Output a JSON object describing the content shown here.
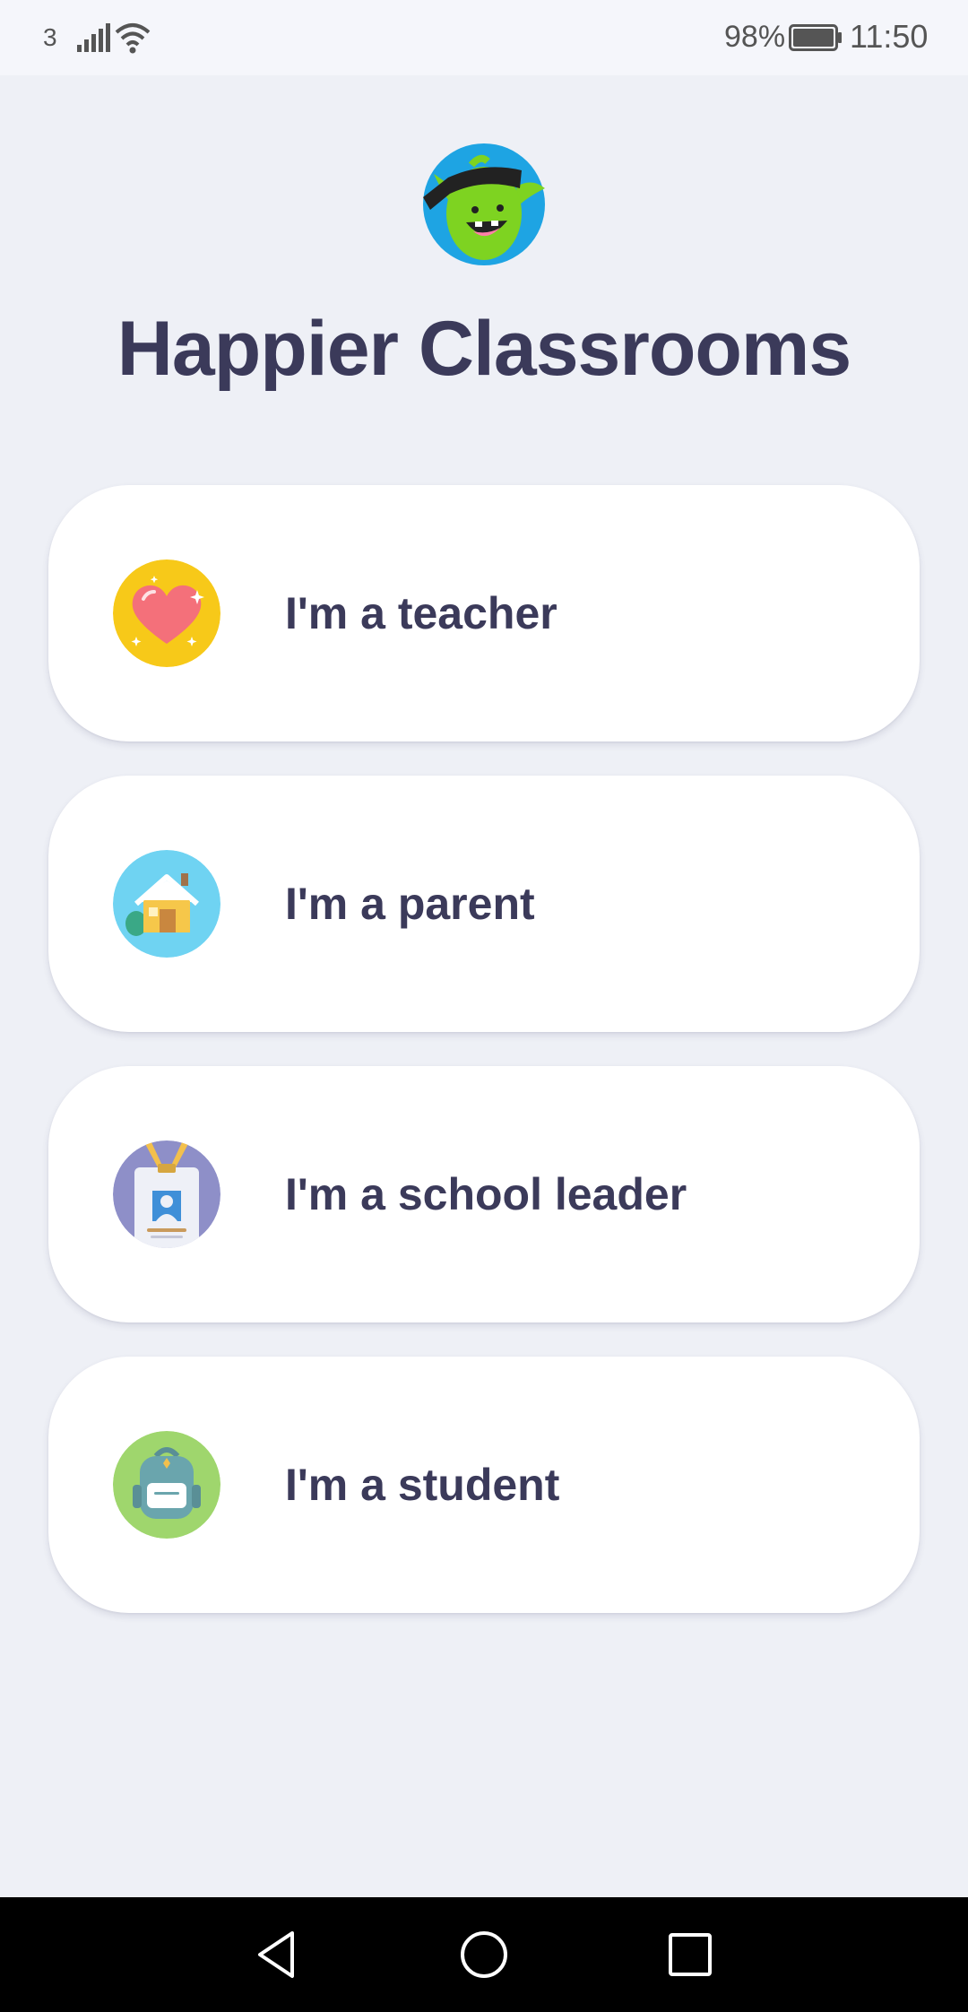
{
  "status_bar": {
    "carrier": "3",
    "battery_percent": "98%",
    "time": "11:50",
    "icons": [
      "signal-icon",
      "wifi-icon",
      "battery-icon"
    ]
  },
  "header": {
    "logo": "classdojo-monster-logo",
    "title": "Happier Classrooms"
  },
  "roles": [
    {
      "label": "I'm a teacher",
      "icon": "heart-icon",
      "icon_bg": "#f7c919"
    },
    {
      "label": "I'm a parent",
      "icon": "house-icon",
      "icon_bg": "#6fd3f2"
    },
    {
      "label": "I'm a school leader",
      "icon": "id-badge-icon",
      "icon_bg": "#8e8fc8"
    },
    {
      "label": "I'm a student",
      "icon": "backpack-icon",
      "icon_bg": "#9fd66d"
    }
  ],
  "nav_bar": {
    "buttons": [
      "back-icon",
      "home-icon",
      "recents-icon"
    ]
  },
  "colors": {
    "background": "#eef0f6",
    "card": "#ffffff",
    "text": "#3b3a5a"
  }
}
